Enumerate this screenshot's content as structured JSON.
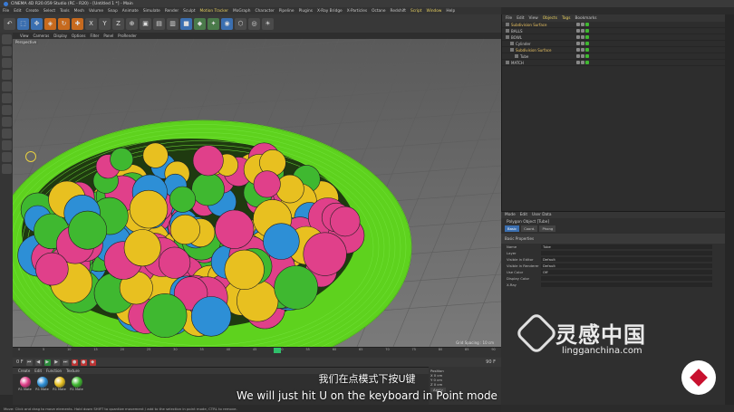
{
  "app": {
    "title": "CINEMA 4D R20.059 Studio (RC - R20) - [Untitled 1 *] - Main"
  },
  "menu": [
    "File",
    "Edit",
    "Create",
    "Select",
    "Tools",
    "Mesh",
    "Volume",
    "Snap",
    "Animate",
    "Simulate",
    "Render",
    "Sculpt",
    "Motion Tracker",
    "MoGraph",
    "Character",
    "Pipeline",
    "Plugins",
    "X-Ray Bridge",
    "X-Particles",
    "Octane",
    "Redshift",
    "Script",
    "Window",
    "Help"
  ],
  "layout": {
    "label": "Layout:",
    "value": "Startup (User)"
  },
  "viewport": {
    "menu": [
      "View",
      "Cameras",
      "Display",
      "Options",
      "Filter",
      "Panel",
      "ProRender"
    ],
    "label": "Perspective",
    "grid_spacing": "Grid Spacing : 10 cm"
  },
  "timeline": {
    "ticks": [
      "0",
      "5",
      "10",
      "15",
      "20",
      "25",
      "30",
      "35",
      "40",
      "45",
      "50",
      "55",
      "60",
      "65",
      "70",
      "75",
      "80",
      "85",
      "90"
    ],
    "current": "0 F",
    "end": "90 F"
  },
  "materials": {
    "menu": [
      "Create",
      "Edit",
      "Function",
      "Texture"
    ],
    "items": [
      {
        "name": "R1 Mate",
        "color": "#e0408a"
      },
      {
        "name": "R1 Mate",
        "color": "#2d8fd6"
      },
      {
        "name": "R1 Mate",
        "color": "#e8c020"
      },
      {
        "name": "R1 Mate",
        "color": "#3fb830"
      }
    ]
  },
  "coords": {
    "header": "Position",
    "rows": [
      "X 0 cm",
      "Y 0 cm",
      "Z 0 cm"
    ],
    "apply": "Apply"
  },
  "object_manager": {
    "menu": [
      "File",
      "Edit",
      "View",
      "Objects",
      "Tags",
      "Bookmarks"
    ],
    "rows": [
      {
        "name": "Subdivision Surface",
        "indent": 0,
        "selected": true
      },
      {
        "name": "BALLS",
        "indent": 0,
        "selected": false
      },
      {
        "name": "BOWL",
        "indent": 0,
        "selected": false
      },
      {
        "name": "Cylinder",
        "indent": 1,
        "selected": false
      },
      {
        "name": "Subdivision Surface",
        "indent": 1,
        "selected": true
      },
      {
        "name": "Tube",
        "indent": 2,
        "selected": false
      },
      {
        "name": "MATCH",
        "indent": 0,
        "selected": false
      }
    ]
  },
  "attributes": {
    "menu": [
      "Mode",
      "Edit",
      "User Data"
    ],
    "title": "Polygon Object [Tube]",
    "tabs": [
      "Basic",
      "Coord.",
      "Phong"
    ],
    "section": "Basic Properties",
    "rows": [
      {
        "label": "Name",
        "value": "Tube"
      },
      {
        "label": "Layer",
        "value": ""
      },
      {
        "label": "Visible in Editor",
        "value": "Default"
      },
      {
        "label": "Visible in Renderer",
        "value": "Default"
      },
      {
        "label": "Use Color",
        "value": "Off"
      },
      {
        "label": "Display Color",
        "value": ""
      },
      {
        "label": "X-Ray",
        "value": ""
      }
    ]
  },
  "status": "Move: Click and drag to move elements. Hold down SHIFT to quantize movement / add to the selection in point mode, CTRL to remove.",
  "subtitles": {
    "zh": "我们在点模式下按U键",
    "en": "We will just hit U on the keyboard in Point mode"
  },
  "watermark": {
    "brand": "灵感中国",
    "url": "lingganchina.com"
  },
  "scene": {
    "bowl_color": "#5ed21e",
    "ball_colors": [
      "#e0408a",
      "#2d8fd6",
      "#e8c020",
      "#3fb830"
    ]
  }
}
